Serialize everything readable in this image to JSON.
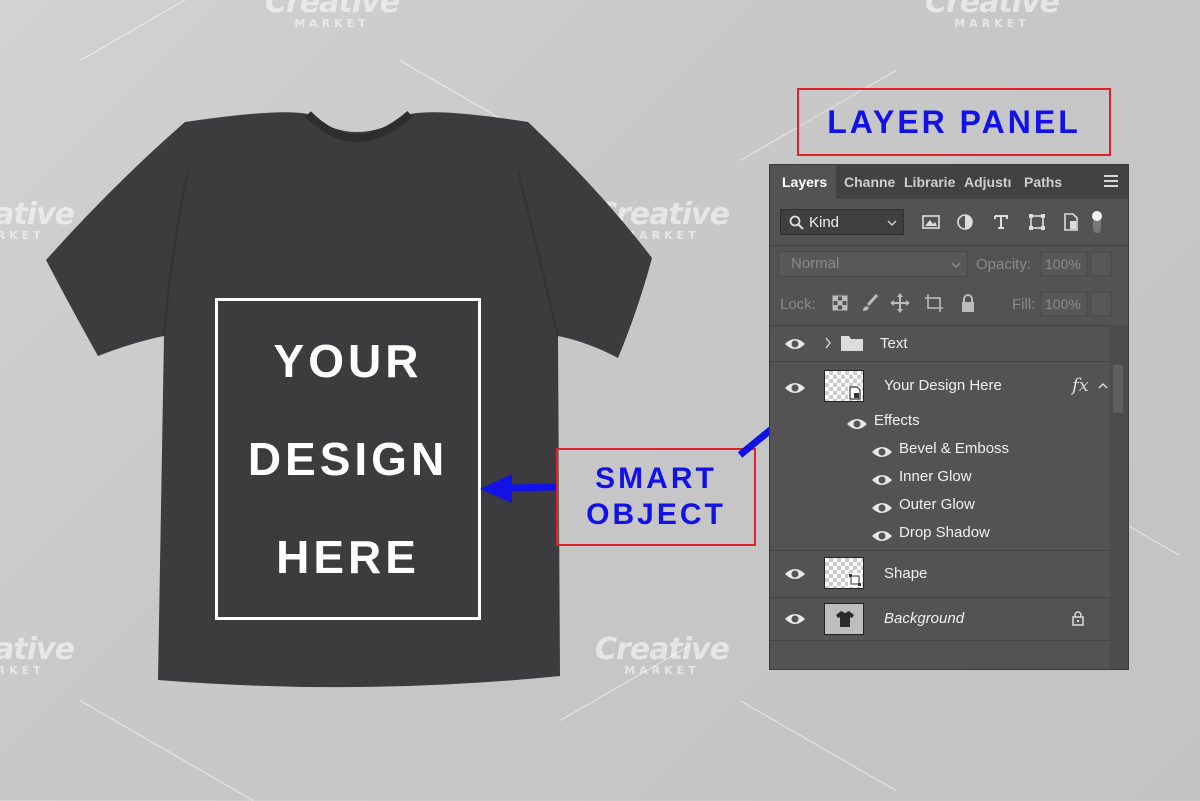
{
  "watermark": {
    "brand": "Creative",
    "sub": "MARKET"
  },
  "mockup": {
    "design_lines": [
      "YOUR",
      "DESIGN",
      "HERE"
    ],
    "shirt_color": "#3c3c3e"
  },
  "callouts": {
    "layer_panel": "LAYER PANEL",
    "smart_object_line1": "SMART",
    "smart_object_line2": "OBJECT",
    "text_color": "#1212e6",
    "border_color": "#e0202a"
  },
  "layers_panel": {
    "tabs": [
      {
        "label": "Layers",
        "active": true
      },
      {
        "label": "Channe",
        "active": false
      },
      {
        "label": "Librarie",
        "active": false
      },
      {
        "label": "Adjustı",
        "active": false
      },
      {
        "label": "Paths",
        "active": false
      }
    ],
    "filter_kind": "Kind",
    "blend_mode": "Normal",
    "opacity_label": "Opacity:",
    "opacity_value": "100%",
    "lock_label": "Lock:",
    "fill_label": "Fill:",
    "fill_value": "100%",
    "layers": [
      {
        "name": "Text",
        "type": "group"
      },
      {
        "name": "Your Design Here",
        "type": "smart-object",
        "fx": "fx"
      },
      {
        "name": "Shape",
        "type": "shape"
      },
      {
        "name": "Background",
        "type": "background"
      }
    ],
    "effects_label": "Effects",
    "effects": [
      "Bevel & Emboss",
      "Inner Glow",
      "Outer Glow",
      "Drop Shadow"
    ]
  }
}
